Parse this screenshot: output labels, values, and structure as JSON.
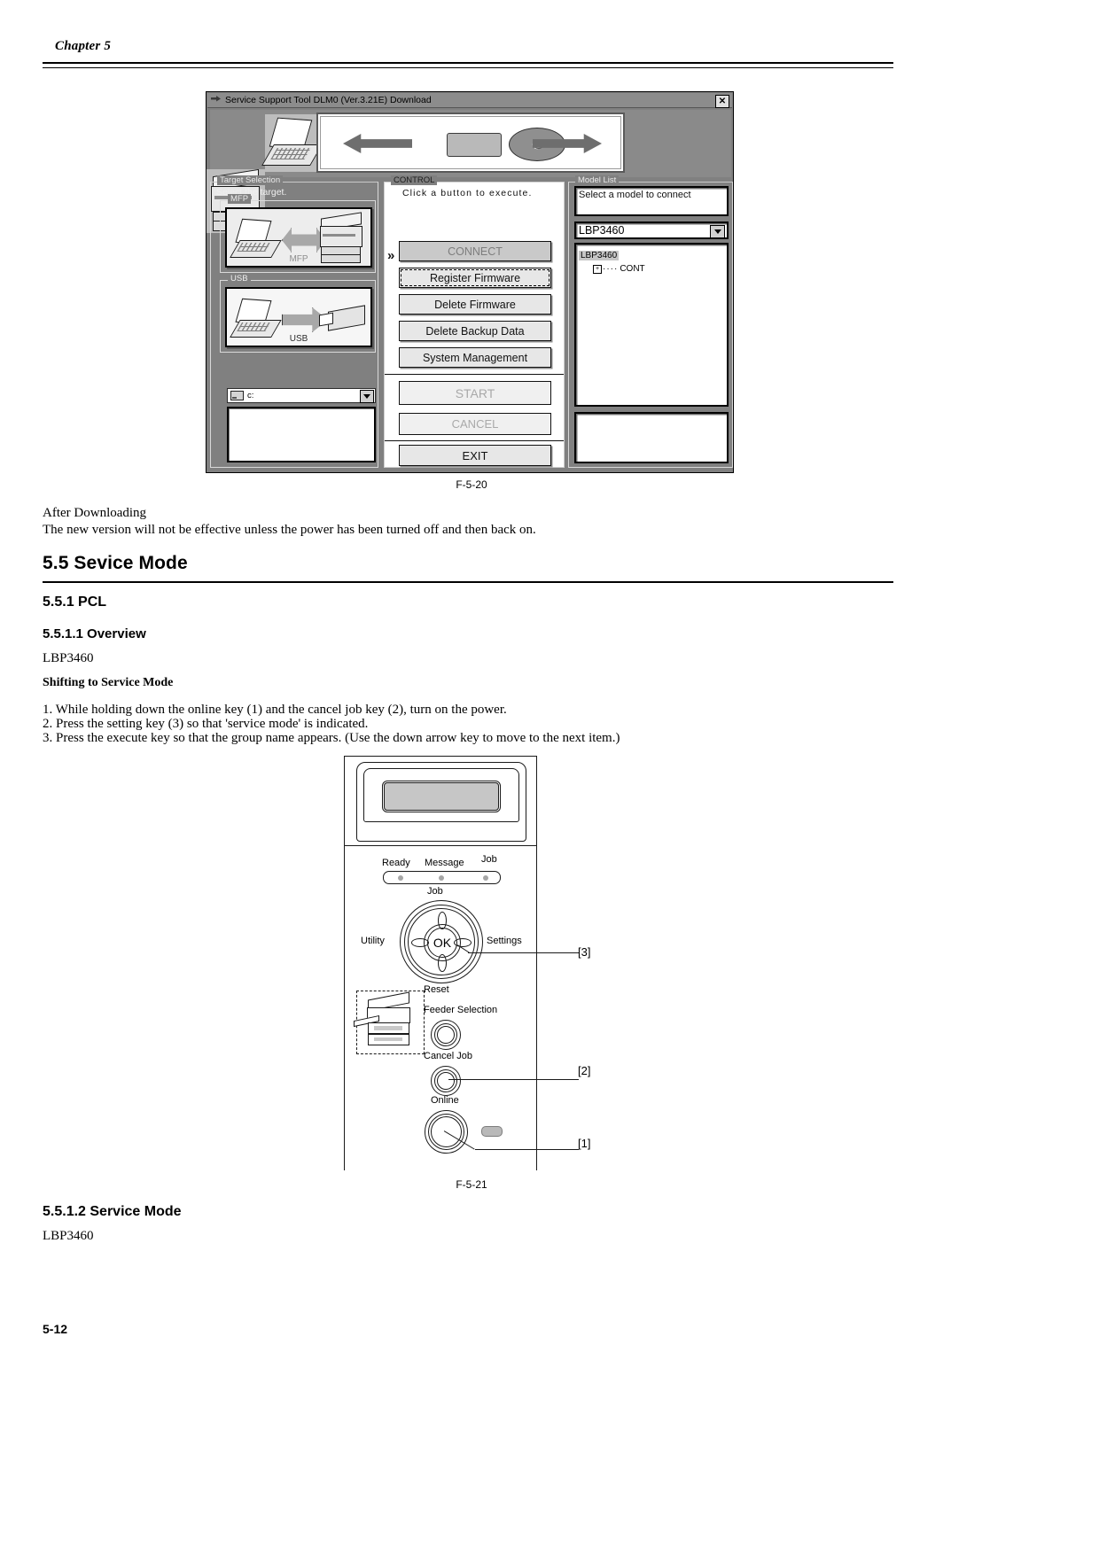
{
  "header": {
    "chapter": "Chapter 5"
  },
  "footer": {
    "page_number": "5-12"
  },
  "figure_5_20": {
    "caption": "F-5-20",
    "window": {
      "title": "Service Support Tool DLM0 (Ver.3.21E) Download",
      "close_label": "✕",
      "icon": "app-icon"
    },
    "target_selection": {
      "group_label": "Target Selection",
      "hint": "Select the target.",
      "mfp_group_label": "MFP",
      "mfp_caption": "MFP",
      "usb_group_label": "USB",
      "usb_caption": "USB",
      "drive_value": "c:",
      "drive_icon": "drive-icon"
    },
    "control": {
      "group_label": "CONTROL",
      "hint": "Click a button to execute.",
      "buttons": [
        {
          "label": "CONNECT",
          "state": "grey"
        },
        {
          "label": "Register Firmware",
          "state": "focus"
        },
        {
          "label": "Delete Firmware",
          "state": "normal"
        },
        {
          "label": "Delete Backup Data",
          "state": "normal"
        },
        {
          "label": "System Management",
          "state": "normal"
        },
        {
          "label": "START",
          "state": "disabled"
        },
        {
          "label": "CANCEL",
          "state": "disabled"
        },
        {
          "label": "EXIT",
          "state": "normal"
        }
      ]
    },
    "model_list": {
      "group_label": "Model List",
      "hint": "Select a model to connect",
      "selected_model": "LBP3460",
      "tree_root": "LBP3460",
      "tree_child": "CONT",
      "expander": "+"
    }
  },
  "after_downloading": {
    "heading": "After Downloading",
    "text": "The new version will not be effective unless the power has been turned off and then back on."
  },
  "sections": {
    "h2": "5.5 Sevice Mode",
    "h3": "5.5.1 PCL",
    "h4_overview": "5.5.1.1 Overview",
    "overview_model": "LBP3460",
    "shifting_heading": "Shifting to Service Mode",
    "steps": [
      "1. While holding down the online key (1) and the cancel job key (2), turn on the power.",
      "2. Press the setting key (3) so that 'service mode' is indicated.",
      "3. Press the execute key so that the group name appears. (Use the down arrow key to move to the next item.)"
    ],
    "h4_service_mode": "5.5.1.2 Service Mode",
    "service_mode_model": "LBP3460"
  },
  "figure_5_21": {
    "caption": "F-5-21",
    "led_labels": [
      "Ready",
      "Message",
      "Job"
    ],
    "dial": {
      "up": "Job",
      "left": "Utility",
      "right": "Settings",
      "down": "Reset",
      "center": "OK"
    },
    "buttons": {
      "feeder_selection": "Feeder Selection",
      "cancel_job": "Cancel Job",
      "online": "Online"
    },
    "callouts": {
      "settings": "[3]",
      "cancel_job": "[2]",
      "online": "[1]"
    }
  }
}
